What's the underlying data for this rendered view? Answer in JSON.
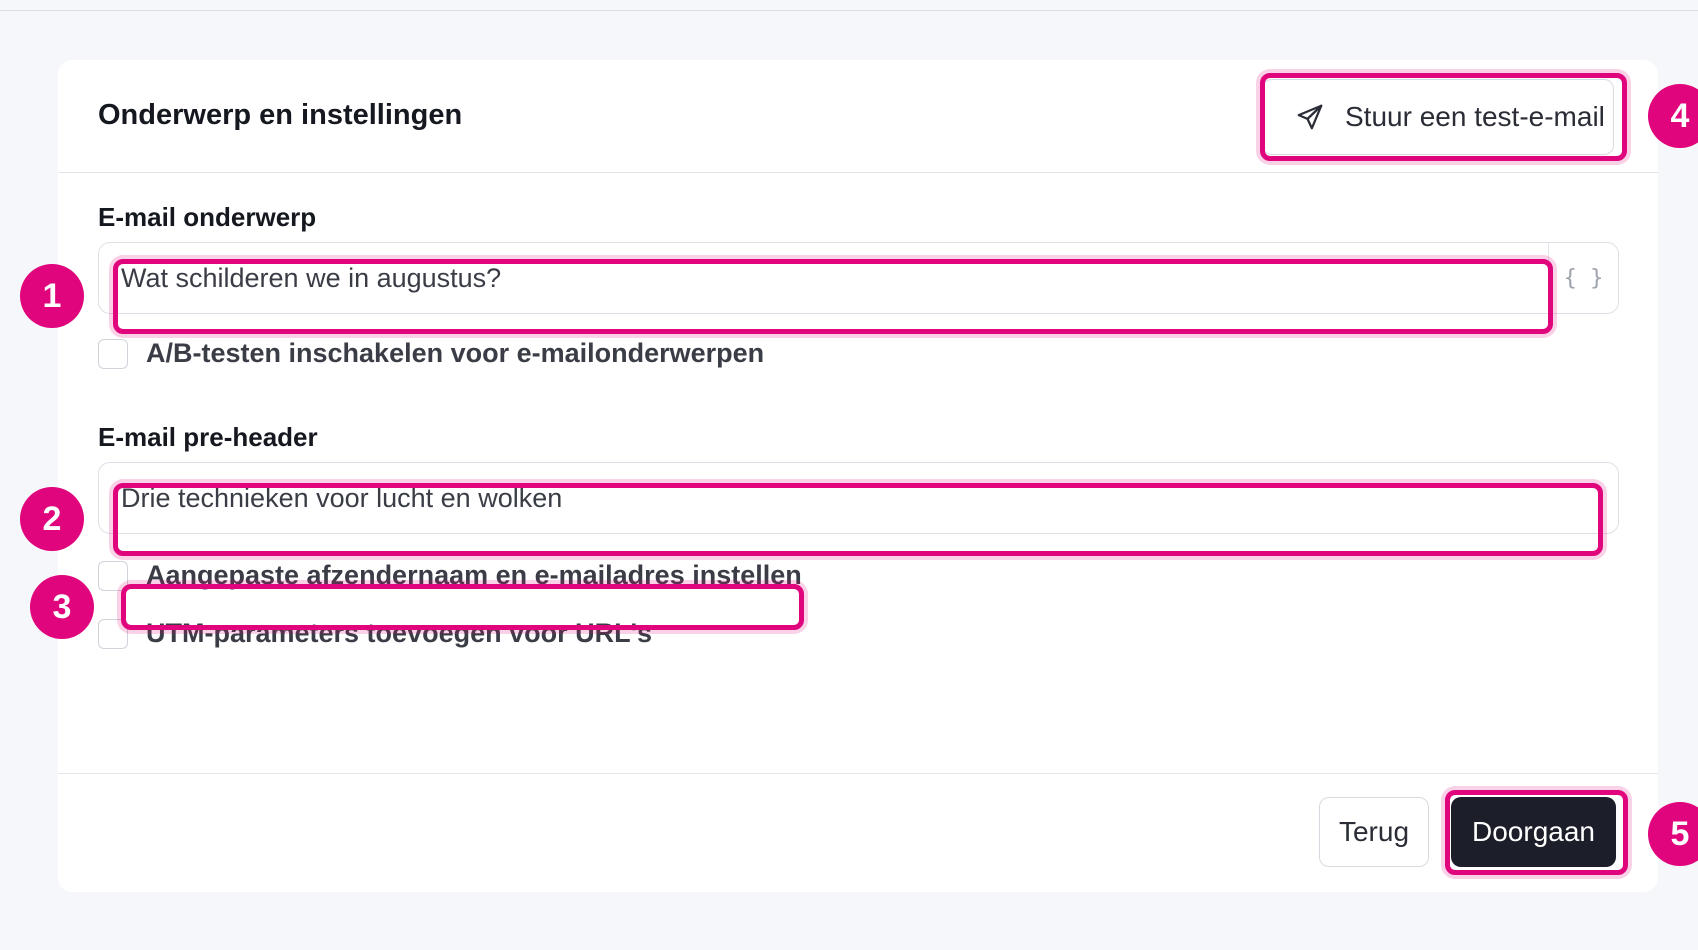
{
  "card": {
    "title": "Onderwerp en instellingen",
    "test_button_label": "Stuur een test-e-mail"
  },
  "subject": {
    "label": "E-mail onderwerp",
    "value": "Wat schilderen we in augustus?",
    "braces": "{ }"
  },
  "ab_test": {
    "label": "A/B-testen inschakelen voor e-mailonderwerpen",
    "checked": false
  },
  "preheader": {
    "label": "E-mail pre-header",
    "value": "Drie technieken voor lucht en wolken"
  },
  "custom_sender": {
    "label": "Aangepaste afzendernaam en e-mailadres instellen",
    "checked": false
  },
  "utm": {
    "label": "UTM-parameters toevoegen voor URL's",
    "checked": false
  },
  "footer": {
    "back_label": "Terug",
    "continue_label": "Doorgaan"
  },
  "annotations": [
    "1",
    "2",
    "3",
    "4",
    "5"
  ],
  "colors": {
    "highlight": "#e0057c",
    "primary_button": "#1c1f2a"
  }
}
